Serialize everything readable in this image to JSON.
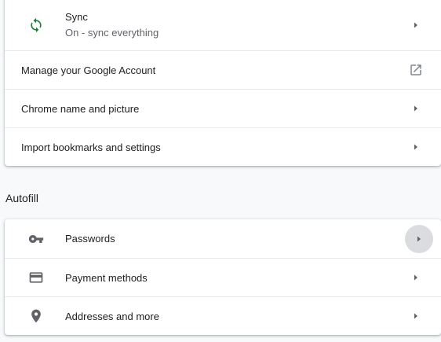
{
  "people_section": {
    "sync": {
      "title": "Sync",
      "subtitle": "On - sync everything",
      "icon": "sync-icon",
      "icon_color": "#188038"
    },
    "manage_account": {
      "label": "Manage your Google Account",
      "icon": "open-in-new-icon"
    },
    "chrome_name": {
      "label": "Chrome name and picture"
    },
    "import_bookmarks": {
      "label": "Import bookmarks and settings"
    }
  },
  "autofill_section": {
    "title": "Autofill",
    "items": [
      {
        "label": "Passwords",
        "icon": "key-icon"
      },
      {
        "label": "Payment methods",
        "icon": "credit-card-icon"
      },
      {
        "label": "Addresses and more",
        "icon": "location-pin-icon"
      }
    ]
  },
  "colors": {
    "page_background": "#f8f9fa",
    "card_background": "#ffffff",
    "icon_gray": "#5f6368",
    "hover_circle": "#dadce0"
  }
}
